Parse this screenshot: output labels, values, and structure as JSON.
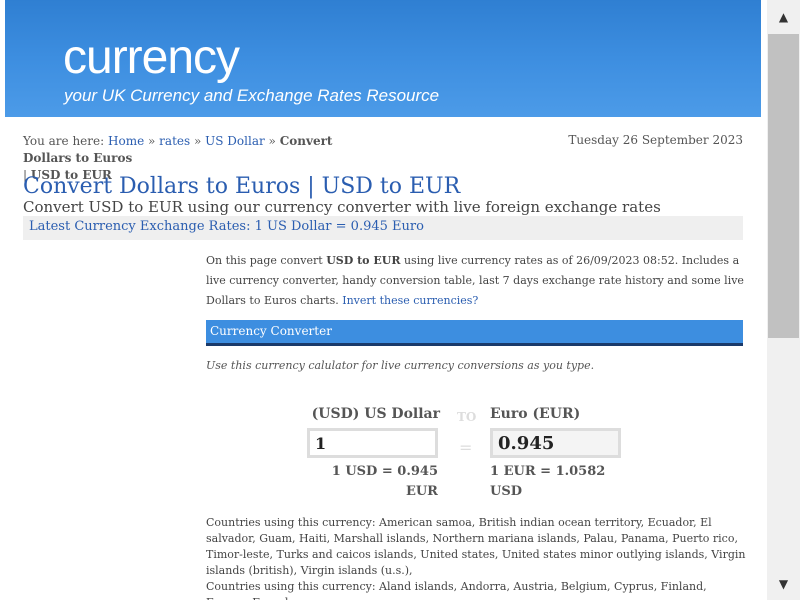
{
  "header": {
    "brand": "currency",
    "tagline": "your UK Currency and Exchange Rates Resource"
  },
  "breadcrumb": {
    "prefix": "You are here:",
    "home": "Home",
    "sep1": "»",
    "rates": "rates",
    "sep2": "»",
    "usdollar": "US Dollar",
    "sep3": "»",
    "current1": "Convert Dollars to Euros",
    "sep4": "|",
    "current2": "USD to EUR"
  },
  "date": "Tuesday 26 September 2023",
  "page_title": "Convert Dollars to Euros | USD to EUR",
  "subtitle": "Convert USD to EUR using our currency converter with live foreign exchange rates",
  "rate_bar": "Latest Currency Exchange Rates: 1 US Dollar = 0.945 Euro",
  "intro": {
    "part1": "On this page convert ",
    "bold": "USD to EUR",
    "part2": " using live currency rates as of 26/09/2023 08:52. Includes a live currency converter, handy conversion table, last 7 days exchange rate history and some live Dollars to Euros charts. ",
    "link": "Invert these currencies?"
  },
  "converter": {
    "title": "Currency Converter",
    "hint": "Use this currency calulator for live currency conversions as you type.",
    "from_label": "(USD) US Dollar",
    "to_label": "Euro (EUR)",
    "to_word": "TO",
    "equals": "=",
    "from_value": "1",
    "to_value": "0.945",
    "from_rate_line1": "1 USD = 0.945",
    "from_rate_line2": "EUR",
    "to_rate_line1": "1 EUR = 1.0582",
    "to_rate_line2": "USD"
  },
  "countries": {
    "usd": "Countries using this currency: American samoa, British indian ocean territory, Ecuador, El salvador, Guam, Haiti, Marshall islands, Northern mariana islands, Palau, Panama, Puerto rico, Timor-leste, Turks and caicos islands, United states, United states minor outlying islands, Virgin islands (british), Virgin islands (u.s.),",
    "eur": "Countries using this currency: Aland islands, Andorra, Austria, Belgium, Cyprus, Finland, France, French"
  },
  "scrollbar": {
    "up_icon": "▲",
    "down_icon": "▼"
  }
}
